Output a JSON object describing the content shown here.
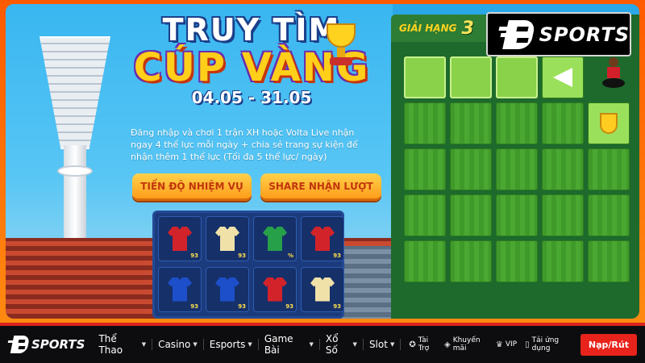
{
  "event": {
    "title_line1": "TRUY TÌM",
    "title_line2": "CÚP VÀNG",
    "dates": "04.05 - 31.05",
    "description": "Đăng nhập và chơi 1 trận XH hoặc Volta Live nhận ngay 4 thể lực mỗi ngày + chia sẻ trang sự kiện để nhận thêm 1 thể lực (Tối đa 5 thể lực/ ngày)",
    "buttons": {
      "mission": "TIẾN ĐỘ NHIỆM VỤ",
      "share": "SHARE NHẬN LƯỢT"
    },
    "shirts": [
      {
        "color": "red",
        "badge": "93"
      },
      {
        "color": "cream",
        "badge": "93"
      },
      {
        "color": "blue",
        "badge": "%"
      },
      {
        "color": "red",
        "badge": "93"
      },
      {
        "color": "blue",
        "badge": "93"
      },
      {
        "color": "blue",
        "badge": "93"
      },
      {
        "color": "red",
        "badge": "93"
      },
      {
        "color": "cream",
        "badge": "93"
      }
    ]
  },
  "board": {
    "rank_label": "GIẢI HẠNG",
    "rank_number": "3"
  },
  "brand": {
    "name": "SPORTS"
  },
  "nav": {
    "logo_text": "SPORTS",
    "items": [
      "Thể Thao",
      "Casino",
      "Esports",
      "Game Bài",
      "Xổ Số",
      "Slot"
    ],
    "utilities": [
      {
        "icon": "sponsor-icon",
        "label": "Tài Trợ"
      },
      {
        "icon": "promo-icon",
        "label": "Khuyến mãi"
      },
      {
        "icon": "vip-icon",
        "label": "VIP"
      },
      {
        "icon": "app-icon",
        "label": "Tải ứng dụng"
      }
    ],
    "cta": "Nạp/Rút"
  },
  "colors": {
    "accent_red": "#e8231b",
    "gold": "#ffd21f",
    "frame_orange": "#ff7a10"
  }
}
